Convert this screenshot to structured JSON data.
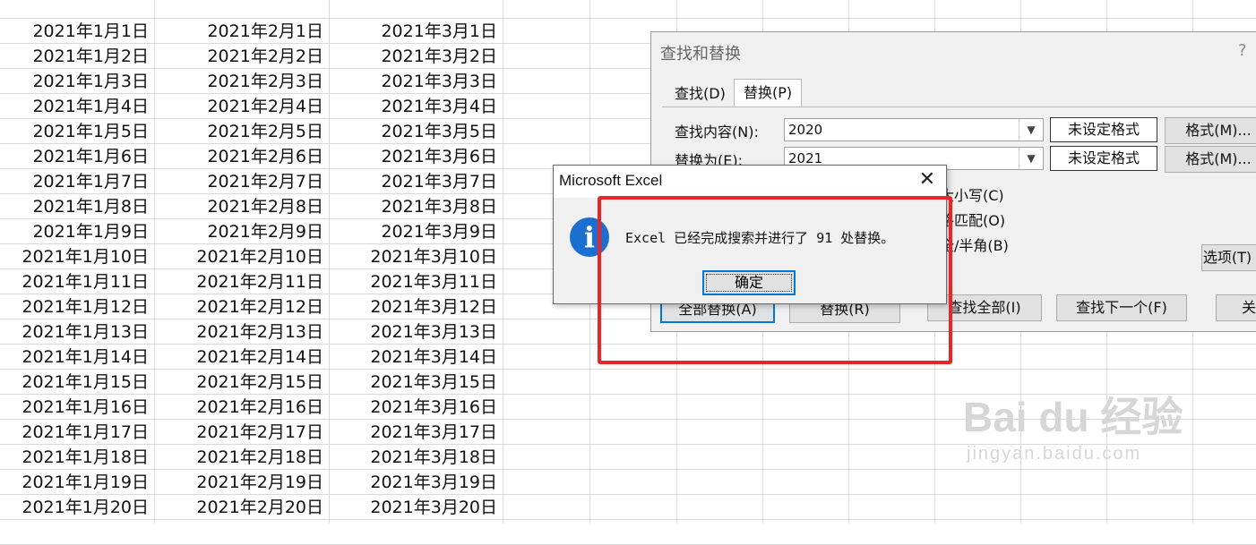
{
  "sheet": {
    "col_a": [
      "2021年1月1日",
      "2021年1月2日",
      "2021年1月3日",
      "2021年1月4日",
      "2021年1月5日",
      "2021年1月6日",
      "2021年1月7日",
      "2021年1月8日",
      "2021年1月9日",
      "2021年1月10日",
      "2021年1月11日",
      "2021年1月12日",
      "2021年1月13日",
      "2021年1月14日",
      "2021年1月15日",
      "2021年1月16日",
      "2021年1月17日",
      "2021年1月18日",
      "2021年1月19日",
      "2021年1月20日"
    ],
    "col_b": [
      "2021年2月1日",
      "2021年2月2日",
      "2021年2月3日",
      "2021年2月4日",
      "2021年2月5日",
      "2021年2月6日",
      "2021年2月7日",
      "2021年2月8日",
      "2021年2月9日",
      "2021年2月10日",
      "2021年2月11日",
      "2021年2月12日",
      "2021年2月13日",
      "2021年2月14日",
      "2021年2月15日",
      "2021年2月16日",
      "2021年2月17日",
      "2021年2月18日",
      "2021年2月19日",
      "2021年2月20日"
    ],
    "col_c": [
      "2021年3月1日",
      "2021年3月2日",
      "2021年3月3日",
      "2021年3月4日",
      "2021年3月5日",
      "2021年3月6日",
      "2021年3月7日",
      "2021年3月8日",
      "2021年3月9日",
      "2021年3月10日",
      "2021年3月11日",
      "2021年3月12日",
      "2021年3月13日",
      "2021年3月14日",
      "2021年3月15日",
      "2021年3月16日",
      "2021年3月17日",
      "2021年3月18日",
      "2021年3月19日",
      "2021年3月20日"
    ]
  },
  "find_replace": {
    "title": "查找和替换",
    "help": "?",
    "tabs": {
      "find": "查找(D)",
      "replace": "替换(P)"
    },
    "find_label": "查找内容(N):",
    "find_value": "2020",
    "replace_label": "替换为(E):",
    "replace_value": "2021",
    "no_format": "未设定格式",
    "format_btn": "格式(M)...",
    "options": {
      "match_case": "区分大小写(C)",
      "match_cell": "单元格匹配(O)",
      "match_width": "区分全/半角(B)"
    },
    "options_btn": "选项(T) <<",
    "buttons": {
      "replace_all": "全部替换(A)",
      "replace": "替换(R)",
      "find_all": "查找全部(I)",
      "find_next": "查找下一个(F)",
      "close": "关闭"
    }
  },
  "message_box": {
    "title": "Microsoft Excel",
    "close": "✕",
    "info_glyph": "i",
    "text": "Excel 已经完成搜索并进行了 91 处替换。",
    "ok": "确定"
  },
  "watermark": {
    "brand": "Bai du 经验",
    "url": "jingyan.baidu.com"
  },
  "colors": {
    "annotation": "#e8262a",
    "info_icon": "#1b6fd1",
    "focus": "#0078d7"
  }
}
